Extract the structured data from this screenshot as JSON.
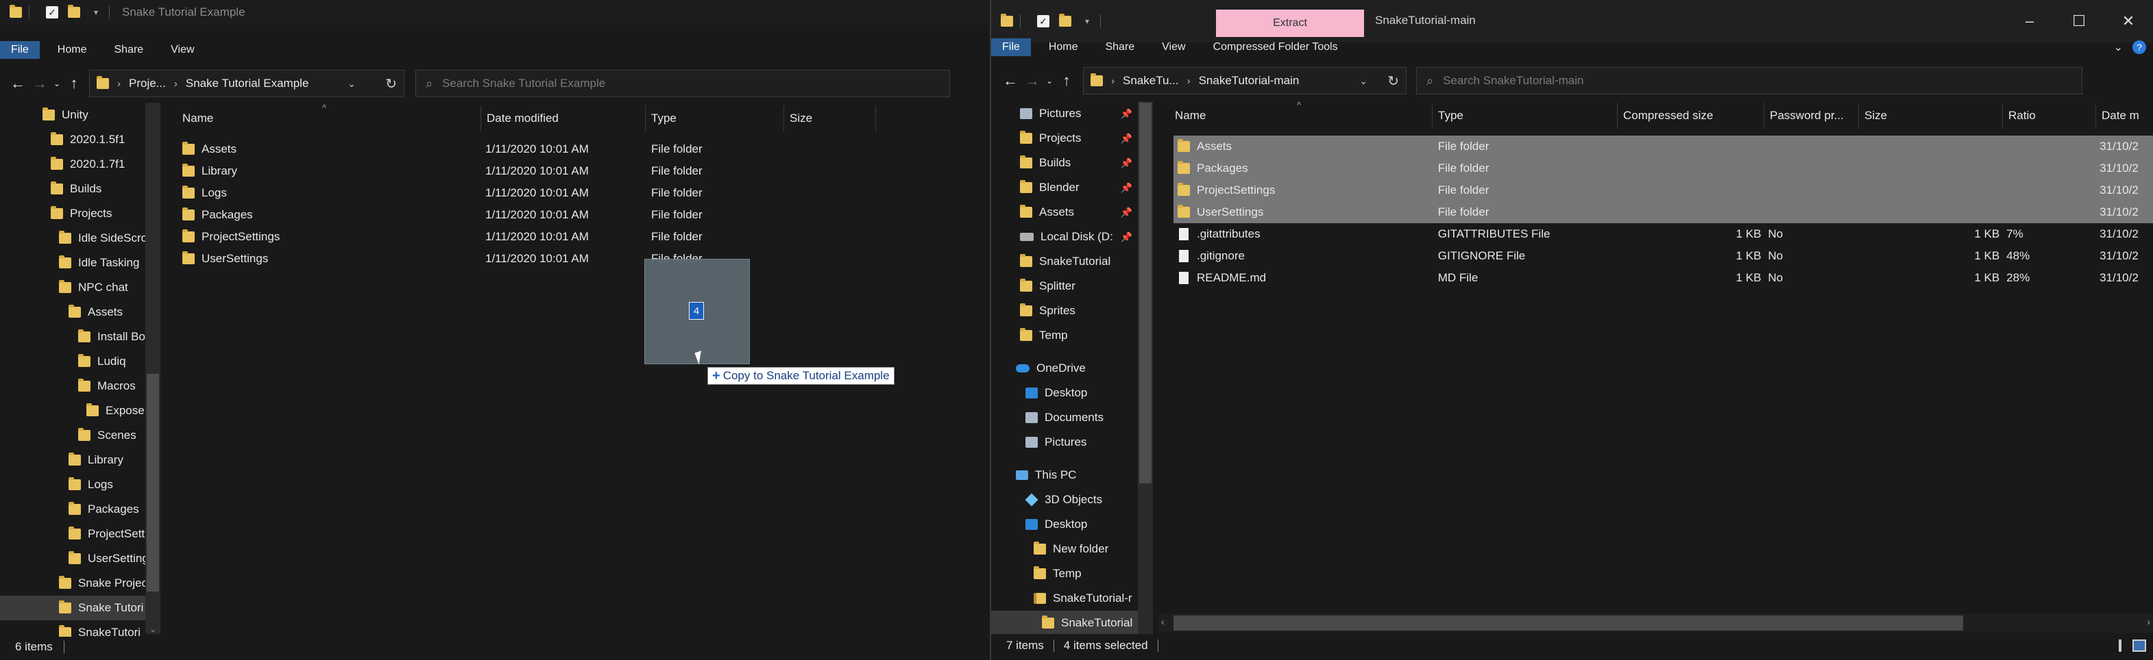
{
  "left_window": {
    "title": "Snake Tutorial Example",
    "ribbon_tabs": [
      "File",
      "Home",
      "Share",
      "View"
    ],
    "breadcrumb": [
      "Proje...",
      "Snake Tutorial Example"
    ],
    "search_placeholder": "Search Snake Tutorial Example",
    "columns": [
      "Name",
      "Date modified",
      "Type",
      "Size"
    ],
    "files": [
      {
        "name": "Assets",
        "date": "1/11/2020 10:01 AM",
        "type": "File folder",
        "size": ""
      },
      {
        "name": "Library",
        "date": "1/11/2020 10:01 AM",
        "type": "File folder",
        "size": ""
      },
      {
        "name": "Logs",
        "date": "1/11/2020 10:01 AM",
        "type": "File folder",
        "size": ""
      },
      {
        "name": "Packages",
        "date": "1/11/2020 10:01 AM",
        "type": "File folder",
        "size": ""
      },
      {
        "name": "ProjectSettings",
        "date": "1/11/2020 10:01 AM",
        "type": "File folder",
        "size": ""
      },
      {
        "name": "UserSettings",
        "date": "1/11/2020 10:01 AM",
        "type": "File folder",
        "size": ""
      }
    ],
    "nav": [
      {
        "label": "Unity"
      },
      {
        "label": "2020.1.5f1"
      },
      {
        "label": "2020.1.7f1"
      },
      {
        "label": "Builds"
      },
      {
        "label": "Projects"
      },
      {
        "label": "Idle SideScro"
      },
      {
        "label": "Idle Tasking"
      },
      {
        "label": "NPC chat"
      },
      {
        "label": "Assets"
      },
      {
        "label": "Install Bo"
      },
      {
        "label": "Ludiq"
      },
      {
        "label": "Macros"
      },
      {
        "label": "Expose"
      },
      {
        "label": "Scenes"
      },
      {
        "label": "Library"
      },
      {
        "label": "Logs"
      },
      {
        "label": "Packages"
      },
      {
        "label": "ProjectSett"
      },
      {
        "label": "UserSetting"
      },
      {
        "label": "Snake Projec"
      },
      {
        "label": "Snake Tutori"
      },
      {
        "label": "SnakeTutori"
      }
    ],
    "status": "6 items"
  },
  "drag": {
    "count": "4",
    "tooltip": "Copy to Snake Tutorial Example"
  },
  "right_window": {
    "title": "SnakeTutorial-main",
    "context_tab": "Extract",
    "ribbon_tabs": [
      "File",
      "Home",
      "Share",
      "View",
      "Compressed Folder Tools"
    ],
    "breadcrumb": [
      "SnakeTu...",
      "SnakeTutorial-main"
    ],
    "search_placeholder": "Search SnakeTutorial-main",
    "columns": [
      "Name",
      "Type",
      "Compressed size",
      "Password pr...",
      "Size",
      "Ratio",
      "Date m"
    ],
    "files": [
      {
        "name": "Assets",
        "type": "File folder",
        "csize": "",
        "pw": "",
        "size": "",
        "ratio": "",
        "date": "31/10/2",
        "icon": "folder",
        "selected": true
      },
      {
        "name": "Packages",
        "type": "File folder",
        "csize": "",
        "pw": "",
        "size": "",
        "ratio": "",
        "date": "31/10/2",
        "icon": "folder",
        "selected": true
      },
      {
        "name": "ProjectSettings",
        "type": "File folder",
        "csize": "",
        "pw": "",
        "size": "",
        "ratio": "",
        "date": "31/10/2",
        "icon": "folder",
        "selected": true
      },
      {
        "name": "UserSettings",
        "type": "File folder",
        "csize": "",
        "pw": "",
        "size": "",
        "ratio": "",
        "date": "31/10/2",
        "icon": "folder",
        "selected": true
      },
      {
        "name": ".gitattributes",
        "type": "GITATTRIBUTES File",
        "csize": "1 KB",
        "pw": "No",
        "size": "1 KB",
        "ratio": "7%",
        "date": "31/10/2",
        "icon": "file",
        "selected": false
      },
      {
        "name": ".gitignore",
        "type": "GITIGNORE File",
        "csize": "1 KB",
        "pw": "No",
        "size": "1 KB",
        "ratio": "48%",
        "date": "31/10/2",
        "icon": "file",
        "selected": false
      },
      {
        "name": "README.md",
        "type": "MD File",
        "csize": "1 KB",
        "pw": "No",
        "size": "1 KB",
        "ratio": "28%",
        "date": "31/10/2",
        "icon": "file",
        "selected": false
      }
    ],
    "nav": [
      {
        "label": "Pictures",
        "pinned": true
      },
      {
        "label": "Projects",
        "pinned": true
      },
      {
        "label": "Builds",
        "pinned": true
      },
      {
        "label": "Blender",
        "pinned": true
      },
      {
        "label": "Assets",
        "pinned": true
      },
      {
        "label": "Local Disk (D:",
        "pinned": true
      },
      {
        "label": "SnakeTutorial"
      },
      {
        "label": "Splitter"
      },
      {
        "label": "Sprites"
      },
      {
        "label": "Temp"
      },
      {
        "label": "OneDrive"
      },
      {
        "label": "Desktop"
      },
      {
        "label": "Documents"
      },
      {
        "label": "Pictures"
      },
      {
        "label": "This PC"
      },
      {
        "label": "3D Objects"
      },
      {
        "label": "Desktop"
      },
      {
        "label": "New folder"
      },
      {
        "label": "Temp"
      },
      {
        "label": "SnakeTutorial-r"
      },
      {
        "label": "SnakeTutorial"
      }
    ],
    "status_items": "7 items",
    "status_selected": "4 items selected"
  }
}
